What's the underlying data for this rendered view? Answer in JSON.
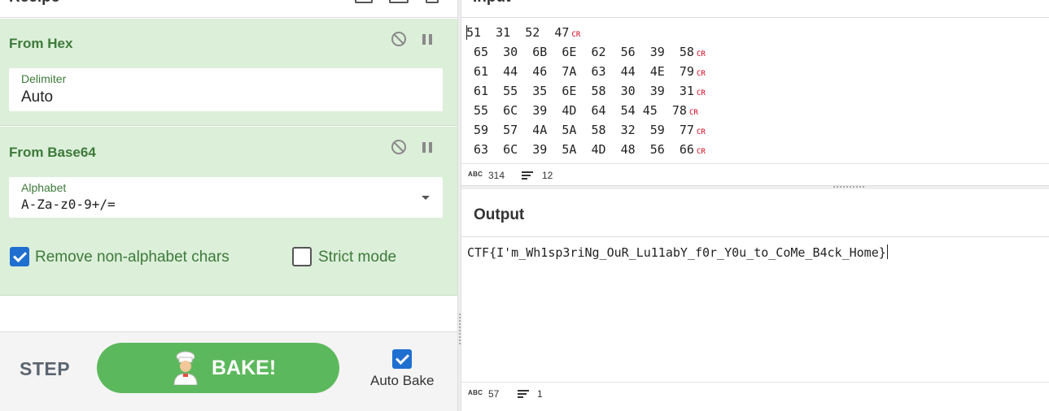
{
  "recipe": {
    "title": "Recipe",
    "operations": [
      {
        "name": "From Hex",
        "fields": [
          {
            "label": "Delimiter",
            "value": "Auto"
          }
        ]
      },
      {
        "name": "From Base64",
        "fields": [
          {
            "label": "Alphabet",
            "value": "A-Za-z0-9+/="
          }
        ],
        "checkboxes": [
          {
            "label": "Remove non-alphabet chars",
            "checked": true
          },
          {
            "label": "Strict mode",
            "checked": false
          }
        ]
      }
    ],
    "controls": {
      "step_label": "STEP",
      "bake_label": "BAKE!",
      "auto_bake_label": "Auto Bake",
      "auto_bake_checked": true
    }
  },
  "input": {
    "title": "Input",
    "lines": [
      "51  31  52  47",
      " 65  30  6B  6E  62  56  39  58",
      " 61  44  46  7A  63  44  4E  79",
      " 61  55  35  6E  58  30  39  31",
      " 55  6C  39  4D  64  54 45  78",
      " 59  57  4A  5A  58  32  59  77",
      " 63  6C  39  5A  4D  48  56  66"
    ],
    "cr_marker": "CR",
    "status": {
      "length_icon": "ABC",
      "length": "314",
      "lines": "12"
    }
  },
  "output": {
    "title": "Output",
    "text": "CTF{I'm_Wh1sp3riNg_OuR_Lu11abY_f0r_Y0u_to_CoMe_B4ck_Home}",
    "status": {
      "length_icon": "ABC",
      "length": "57",
      "lines": "1"
    }
  },
  "icons": {
    "disable": "disable-icon",
    "pause": "pause-icon",
    "chef": "chef-icon",
    "lines": "lines-icon"
  },
  "colors": {
    "operation_bg": "#dcefd9",
    "operation_text": "#3d7a3a",
    "bake_button": "#5cb85c",
    "checkbox_on": "#1f6fd0",
    "cr_marker": "#d0021b"
  }
}
